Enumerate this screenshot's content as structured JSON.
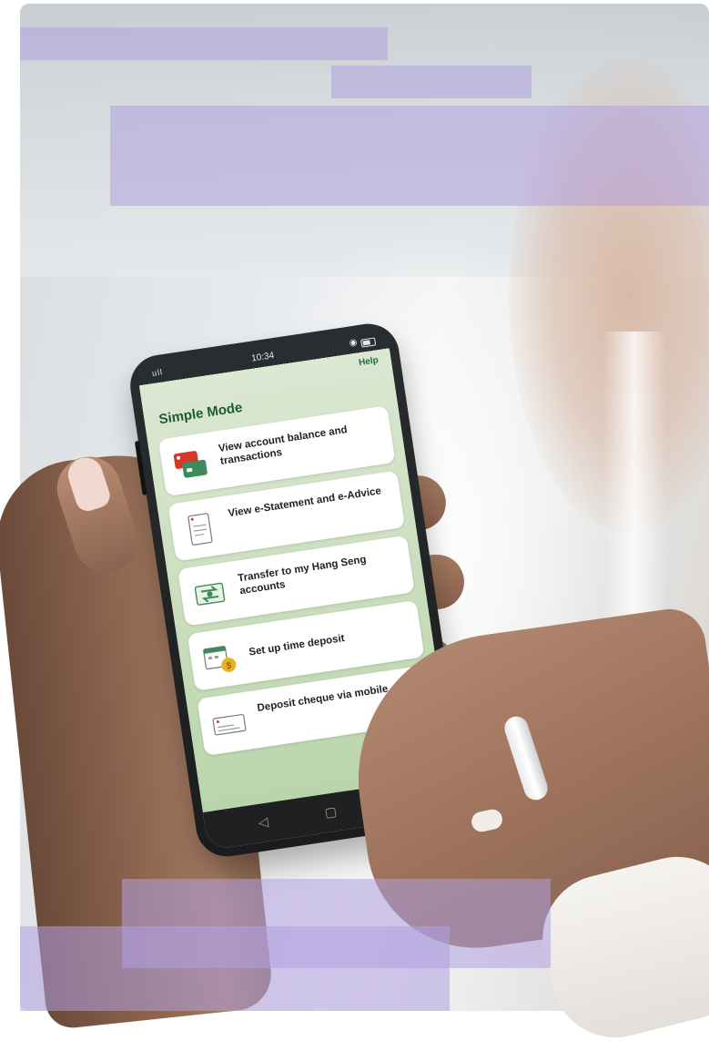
{
  "phone": {
    "status": {
      "signal": "ull",
      "time": "10:34"
    },
    "help_label": "Help",
    "title": "Simple Mode",
    "items": [
      {
        "label": "View account balance and transactions",
        "icon": "cards-icon"
      },
      {
        "label": "View e-Statement and e-Advice",
        "icon": "document-icon"
      },
      {
        "label": "Transfer to my Hang Seng accounts",
        "icon": "transfer-icon"
      },
      {
        "label": "Set up time deposit",
        "icon": "calendar-coin-icon"
      },
      {
        "label": "Deposit cheque via mobile",
        "icon": "cheque-icon"
      }
    ],
    "nav": {
      "back": "◁",
      "home": "▢",
      "recent": "△"
    }
  },
  "colors": {
    "title_green": "#1c5c34",
    "screen_green": "#c6dcba",
    "redaction": "#b0a0e0"
  }
}
